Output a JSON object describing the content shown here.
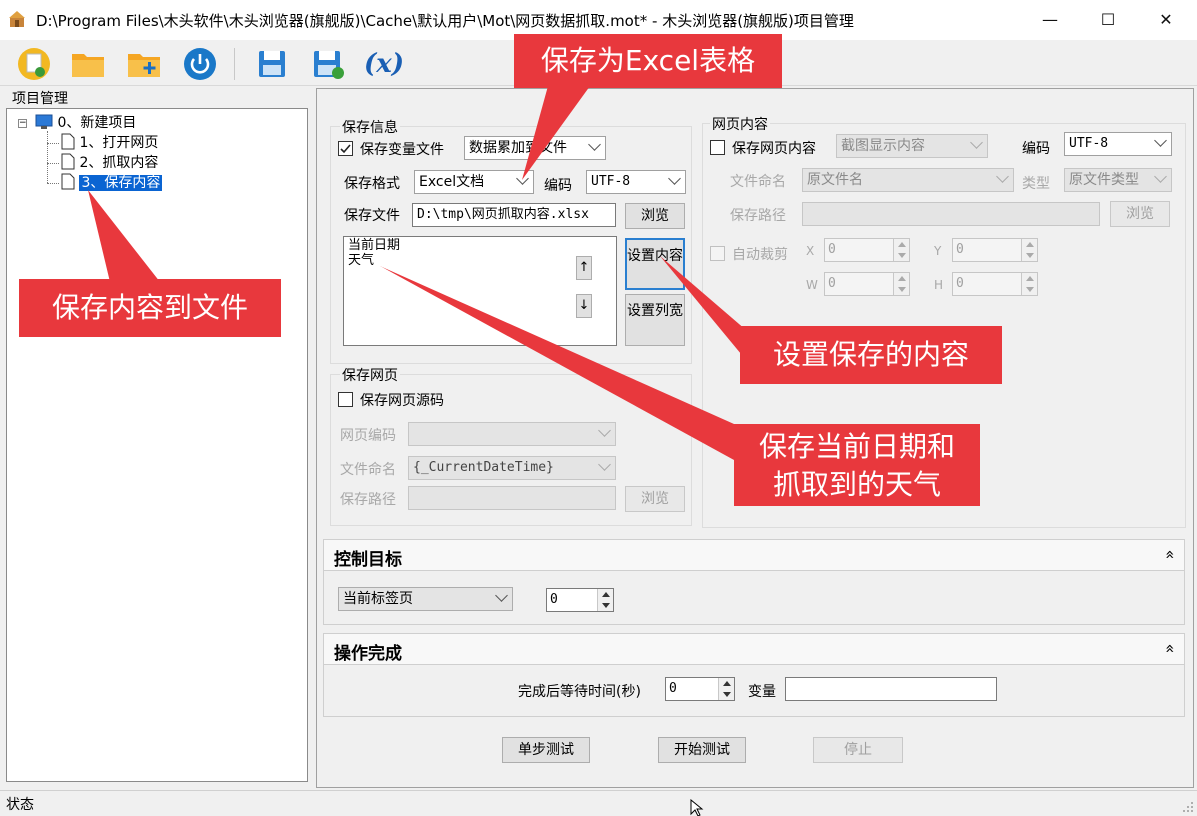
{
  "window": {
    "title": "D:\\Program Files\\木头软件\\木头浏览器(旗舰版)\\Cache\\默认用户\\Mot\\网页数据抓取.mot* - 木头浏览器(旗舰版)项目管理",
    "minimize": "—",
    "maximize": "☐",
    "close": "✕"
  },
  "toolbar": {
    "items": [
      "new-project",
      "open-folder",
      "add-folder",
      "power",
      "save",
      "save-as",
      "variable"
    ],
    "variable_label": "(x)"
  },
  "project_panel": {
    "label": "项目管理",
    "tree": [
      {
        "label": "0、新建项目",
        "level": 0
      },
      {
        "label": "1、打开网页",
        "level": 1
      },
      {
        "label": "2、抓取内容",
        "level": 1
      },
      {
        "label": "3、保存内容",
        "level": 1,
        "selected": true
      }
    ]
  },
  "save_info": {
    "group_label": "保存信息",
    "save_var_file_label": "保存变量文件",
    "save_var_file_checked": true,
    "mode_value": "数据累加到文件",
    "format_label": "保存格式",
    "format_value": "Excel文档",
    "encoding_label": "编码",
    "encoding_value": "UTF-8",
    "file_label": "保存文件",
    "file_value": "D:\\tmp\\网页抓取内容.xlsx",
    "browse": "浏览",
    "content_items": [
      "当前日期",
      "天气"
    ],
    "up_arrow": "↑",
    "down_arrow": "↓",
    "set_content": "设置内容",
    "set_preview": "设置列宽"
  },
  "page_content": {
    "group_label": "网页内容",
    "save_page_content_label": "保存网页内容",
    "save_page_content_checked": false,
    "screenshot_mode": "截图显示内容",
    "encoding_label": "编码",
    "encoding_value": "UTF-8",
    "file_naming_label": "文件命名",
    "file_naming_value": "原文件名",
    "type_label": "类型",
    "type_value": "原文件类型",
    "save_path_label": "保存路径",
    "browse": "浏览",
    "auto_crop_label": "自动裁剪",
    "x_label": "X",
    "y_label": "Y",
    "w_label": "W",
    "h_label": "H",
    "x_value": "0",
    "y_value": "0",
    "w_value": "0",
    "h_value": "0"
  },
  "save_page": {
    "group_label": "保存网页",
    "save_source_label": "保存网页源码",
    "save_source_checked": false,
    "page_encoding_label": "网页编码",
    "file_naming_label": "文件命名",
    "file_naming_value": "{_CurrentDateTime}",
    "save_path_label": "保存路径",
    "browse": "浏览"
  },
  "control_target": {
    "title": "控制目标",
    "collapse_icon": "»",
    "target_value": "当前标签页",
    "index_value": "0"
  },
  "operation_done": {
    "title": "操作完成",
    "collapse_icon": "»",
    "wait_label": "完成后等待时间(秒)",
    "wait_value": "0",
    "variable_label": "变量",
    "variable_value": ""
  },
  "actions": {
    "step_test": "单步测试",
    "start_test": "开始测试",
    "stop": "停止"
  },
  "status_bar": {
    "label": "状态"
  },
  "callouts": {
    "save_as_excel": "保存为Excel表格",
    "save_to_file": "保存内容到文件",
    "set_save_content": "设置保存的内容",
    "save_date_weather_line1": "保存当前日期和",
    "save_date_weather_line2": "抓取到的天气"
  },
  "colors": {
    "callout_red": "#e8383d",
    "selection_blue": "#0a64d2"
  }
}
